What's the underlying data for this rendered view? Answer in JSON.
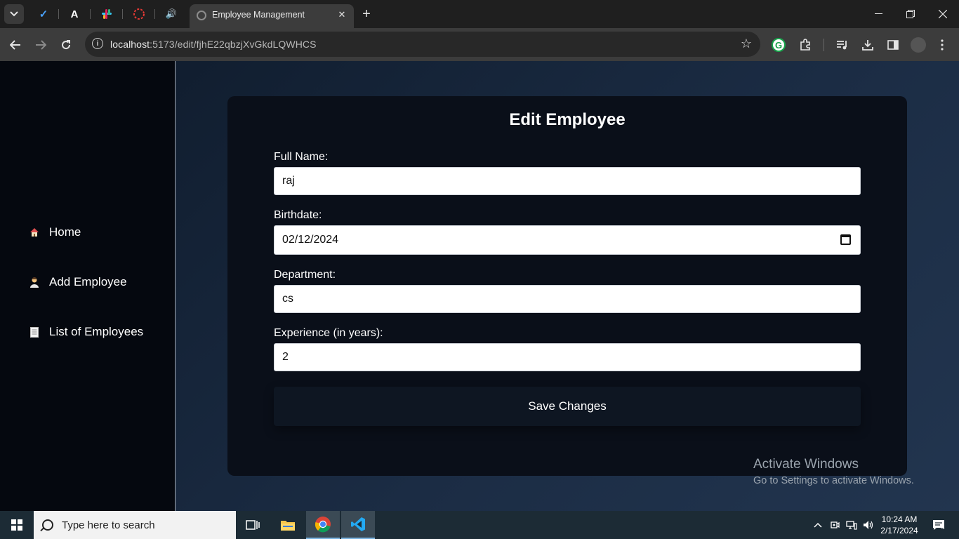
{
  "browser": {
    "active_tab_title": "Employee Management",
    "url_host": "localhost",
    "url_rest": ":5173/edit/fjhE22qbzjXvGkdLQWHCS",
    "new_tab_symbol": "+",
    "pinned_tabs": [
      "todo-check-icon",
      "a-letter-icon",
      "slack-icon",
      "opera-icon",
      "speaker-icon"
    ]
  },
  "sidebar": {
    "items": [
      {
        "label": "Home",
        "icon": "house-icon"
      },
      {
        "label": "Add Employee",
        "icon": "person-icon"
      },
      {
        "label": "List of Employees",
        "icon": "document-icon"
      }
    ]
  },
  "form": {
    "title": "Edit Employee",
    "full_name_label": "Full Name:",
    "full_name_value": "raj",
    "birthdate_label": "Birthdate:",
    "birthdate_value": "02/12/2024",
    "department_label": "Department:",
    "department_value": "cs",
    "experience_label": "Experience (in years):",
    "experience_value": "2",
    "save_label": "Save Changes"
  },
  "watermark": {
    "line1": "Activate Windows",
    "line2": "Go to Settings to activate Windows."
  },
  "taskbar": {
    "search_placeholder": "Type here to search",
    "time": "10:24 AM",
    "date": "2/17/2024",
    "notification_count": "4"
  },
  "colors": {
    "sidebar_bg": "#05080f",
    "card_bg": "#0a0f19",
    "page_bg": "#1b2c44",
    "button_bg": "#0e1622"
  }
}
